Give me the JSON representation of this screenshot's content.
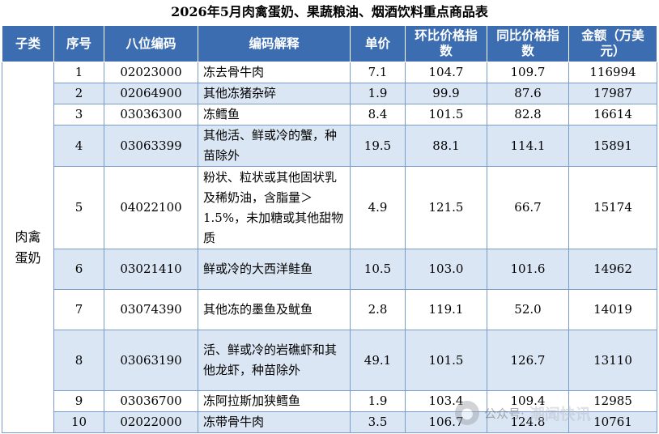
{
  "title": "2026年5月肉禽蛋奶、果蔬粮油、烟酒饮料重点商品表",
  "headers": {
    "category": "子类",
    "index": "序号",
    "code": "八位编码",
    "desc": "编码解释",
    "price": "单价",
    "mom": "环比价格指数",
    "yoy": "同比价格指数",
    "amount": "金额（万美元）"
  },
  "category": "肉禽蛋奶",
  "rows": [
    {
      "index": "1",
      "code": "02023000",
      "desc": "冻去骨牛肉",
      "price": "7.1",
      "mom": "104.7",
      "yoy": "109.7",
      "amount": "116994"
    },
    {
      "index": "2",
      "code": "02064900",
      "desc": "其他冻猪杂碎",
      "price": "1.9",
      "mom": "99.9",
      "yoy": "87.6",
      "amount": "17987"
    },
    {
      "index": "3",
      "code": "03036300",
      "desc": "冻鳕鱼",
      "price": "8.4",
      "mom": "101.5",
      "yoy": "82.8",
      "amount": "16614"
    },
    {
      "index": "4",
      "code": "03063399",
      "desc": "其他活、鲜或冷的蟹，种苗除外",
      "price": "19.5",
      "mom": "88.1",
      "yoy": "114.1",
      "amount": "15891"
    },
    {
      "index": "5",
      "code": "04022100",
      "desc": "粉状、粒状或其他固状乳及稀奶油，含脂量＞1.5%，未加糖或其他甜物质",
      "price": "4.9",
      "mom": "121.5",
      "yoy": "66.7",
      "amount": "15174"
    },
    {
      "index": "6",
      "code": "03021410",
      "desc": "鲜或冷的大西洋鲑鱼",
      "price": "10.5",
      "mom": "103.0",
      "yoy": "101.6",
      "amount": "14962"
    },
    {
      "index": "7",
      "code": "03074390",
      "desc": "其他冻的墨鱼及鱿鱼",
      "price": "2.8",
      "mom": "119.1",
      "yoy": "52.0",
      "amount": "14019"
    },
    {
      "index": "8",
      "code": "03063190",
      "desc": "活、鲜或冷的岩礁虾和其他龙虾，种苗除外",
      "price": "49.1",
      "mom": "101.5",
      "yoy": "126.7",
      "amount": "13110"
    },
    {
      "index": "9",
      "code": "03036700",
      "desc": "冻阿拉斯加狭鳕鱼",
      "price": "1.9",
      "mom": "103.4",
      "yoy": "109.4",
      "amount": "12985"
    },
    {
      "index": "10",
      "code": "02022000",
      "desc": "冻带骨牛肉",
      "price": "3.5",
      "mom": "106.7",
      "yoy": "124.8",
      "amount": "10761"
    }
  ],
  "watermark": {
    "logo_icon": "wechat-icon",
    "label": "公众号·",
    "brand": "潮闻快讯"
  }
}
